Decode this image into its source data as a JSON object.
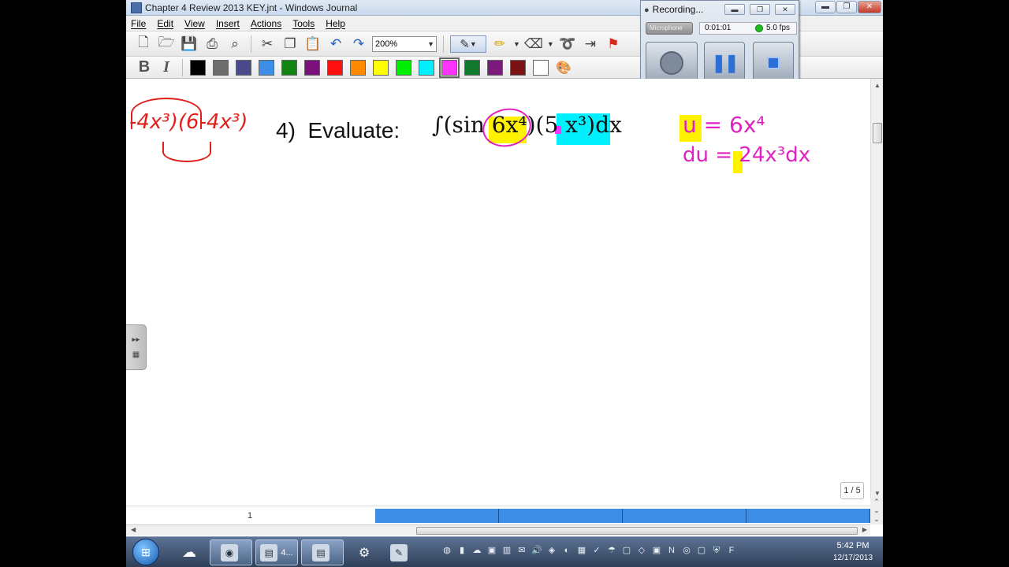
{
  "window": {
    "title": "Chapter 4 Review 2013 KEY.jnt - Windows Journal",
    "minimize": "▬",
    "maximize": "❐",
    "close": "✕"
  },
  "menu": [
    "File",
    "Edit",
    "View",
    "Insert",
    "Actions",
    "Tools",
    "Help"
  ],
  "toolbar": {
    "zoom": "200%",
    "icons": [
      "new-page-icon",
      "open-icon",
      "save-icon",
      "print-preview-icon",
      "search-icon",
      "cut-icon",
      "copy-icon",
      "paste-icon",
      "undo-icon",
      "redo-icon",
      "pen-icon",
      "highlighter-icon",
      "eraser-icon",
      "lasso-icon",
      "insert-space-icon",
      "flag-icon"
    ]
  },
  "format": {
    "bold": "B",
    "italic": "I",
    "colors": [
      "#000000",
      "#6d6d6d",
      "#4b4b8c",
      "#3c8ee6",
      "#128412",
      "#7b117b",
      "#ff1010",
      "#ff8a00",
      "#ffff00",
      "#00ee00",
      "#00f0ff",
      "#ff33ff",
      "#127a2e",
      "#7d1b7d",
      "#7a1414",
      "#ffffff"
    ],
    "selected_color": "#ff33ff"
  },
  "recorder": {
    "title": "Recording...",
    "input": "Microphone",
    "time": "0:01:01",
    "fps": "5.0 fps"
  },
  "document": {
    "problem_number": "4)",
    "problem_label": "Evaluate:",
    "integral": "∫(sin 6x⁴)(5 x³)dx",
    "left_work": "-4x³)(6-4x³)",
    "u_sub": "u = 6x⁴",
    "du_sub": "du = 24x³dx",
    "page_indicator": "1 / 5"
  },
  "pagebar": {
    "page_number": "1"
  },
  "taskbar": {
    "tasks": [
      "4..."
    ],
    "time": "5:42 PM",
    "date": "12/17/2013"
  }
}
